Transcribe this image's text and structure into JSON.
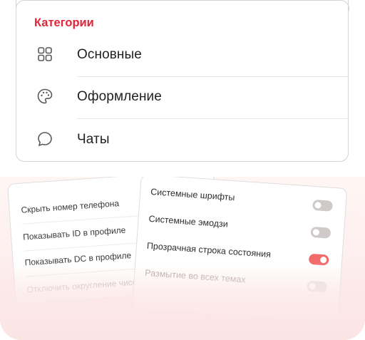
{
  "categories": {
    "title": "Категории",
    "items": [
      {
        "label": "Основные",
        "icon": "grid-icon"
      },
      {
        "label": "Оформление",
        "icon": "palette-icon"
      },
      {
        "label": "Чаты",
        "icon": "chat-bubble-icon"
      }
    ]
  },
  "preview_back": {
    "items": [
      "Скрыть номер телефона",
      "Показывать ID в профиле",
      "Показывать DC в профиле",
      "Отключить округление чисел"
    ]
  },
  "preview_front": {
    "items": [
      {
        "label": "Системные шрифты",
        "on": false
      },
      {
        "label": "Системные эмодзи",
        "on": false
      },
      {
        "label": "Прозрачная строка состояния",
        "on": true
      },
      {
        "label": "Размытие во всех темах",
        "on": false
      }
    ]
  },
  "colors": {
    "accent": "#e0253a",
    "toggle_on": "#f26b6b",
    "toggle_off": "#d0c9c9"
  }
}
